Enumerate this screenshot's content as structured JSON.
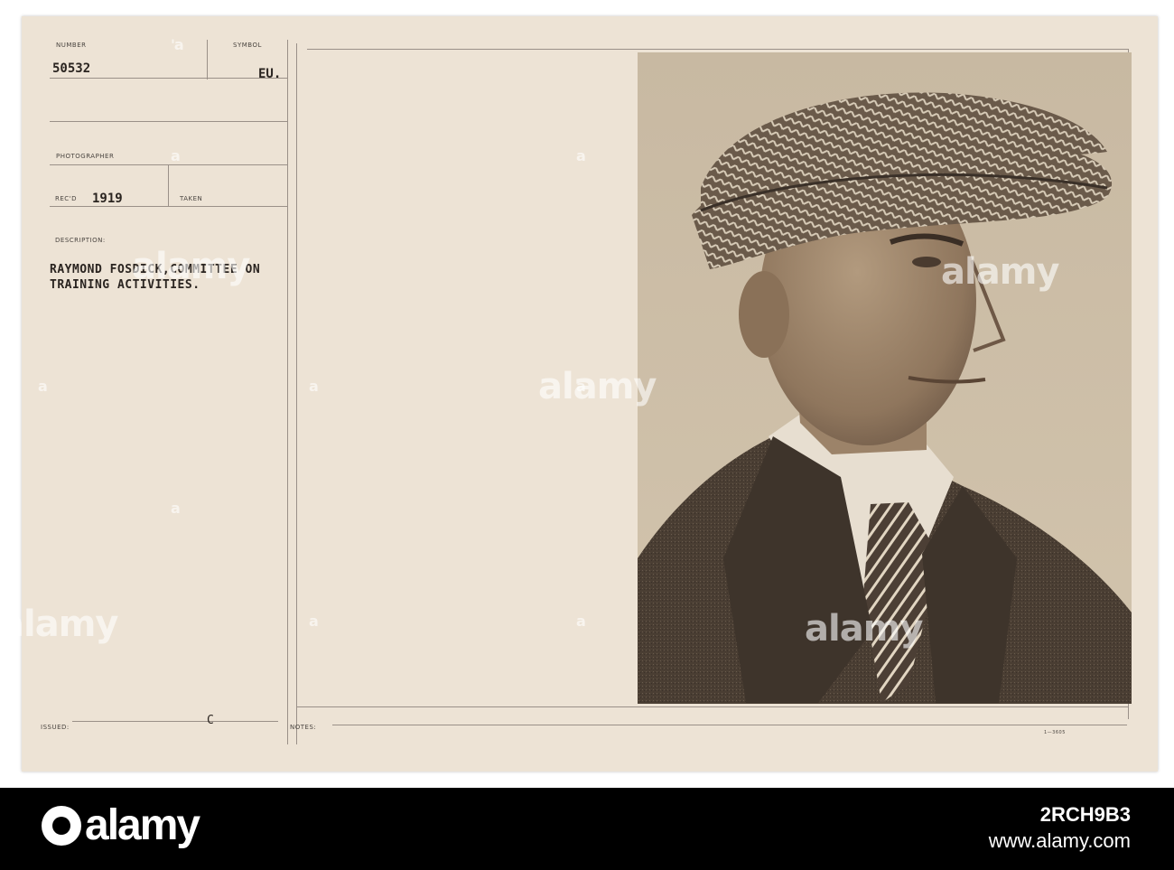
{
  "card": {
    "number_label": "NUMBER",
    "number_value": "50532",
    "symbol_label": "SYMBOL",
    "symbol_value": "EU.",
    "photographer_label": "PHOTOGRAPHER",
    "recd_label": "REC'D",
    "recd_value": "1919",
    "taken_label": "TAKEN",
    "description_label": "DESCRIPTION:",
    "description_text": "RAYMOND FOSDICK,COMMITTEE ON\nTRAINING ACTIVITIES.",
    "issued_label": "ISSUED:",
    "issued_mark": "C",
    "notes_label": "NOTES:",
    "form_code": "1—3605"
  },
  "watermark": {
    "text": "alamy"
  },
  "footer": {
    "logo": "alamy",
    "stock_id": "2RCH9B3",
    "url": "www.alamy.com"
  }
}
